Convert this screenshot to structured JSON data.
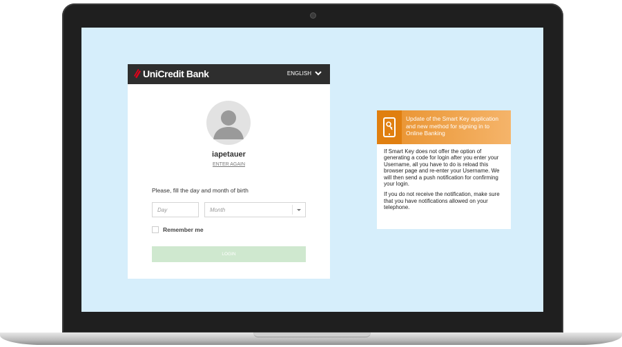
{
  "header": {
    "brand": "UniCredit Bank",
    "language": "ENGLISH"
  },
  "login": {
    "username": "iapetauer",
    "enter_again": "ENTER AGAIN",
    "dob_label": "Please, fill the day and month of birth",
    "day_placeholder": "Day",
    "month_placeholder": "Month",
    "remember_label": "Remember me",
    "login_label": "LOGIN"
  },
  "info": {
    "title": "Update of the Smart Key application and new method for signing in to Online Banking",
    "paragraph1": "If Smart Key does not offer the option of generating a code for login after you enter your Username, all you have to do is reload this browser page and re-enter your Username. We will then send a push notification for confirming your login.",
    "paragraph2": "If you do not receive the notification, make sure that you have notifications allowed on your telephone."
  },
  "colors": {
    "brand_red": "#e2001a",
    "header_dark": "#2e2e2e",
    "accent_orange": "#e8902a",
    "login_button": "#cfe8cf",
    "screen_bg": "#d6eefb"
  }
}
